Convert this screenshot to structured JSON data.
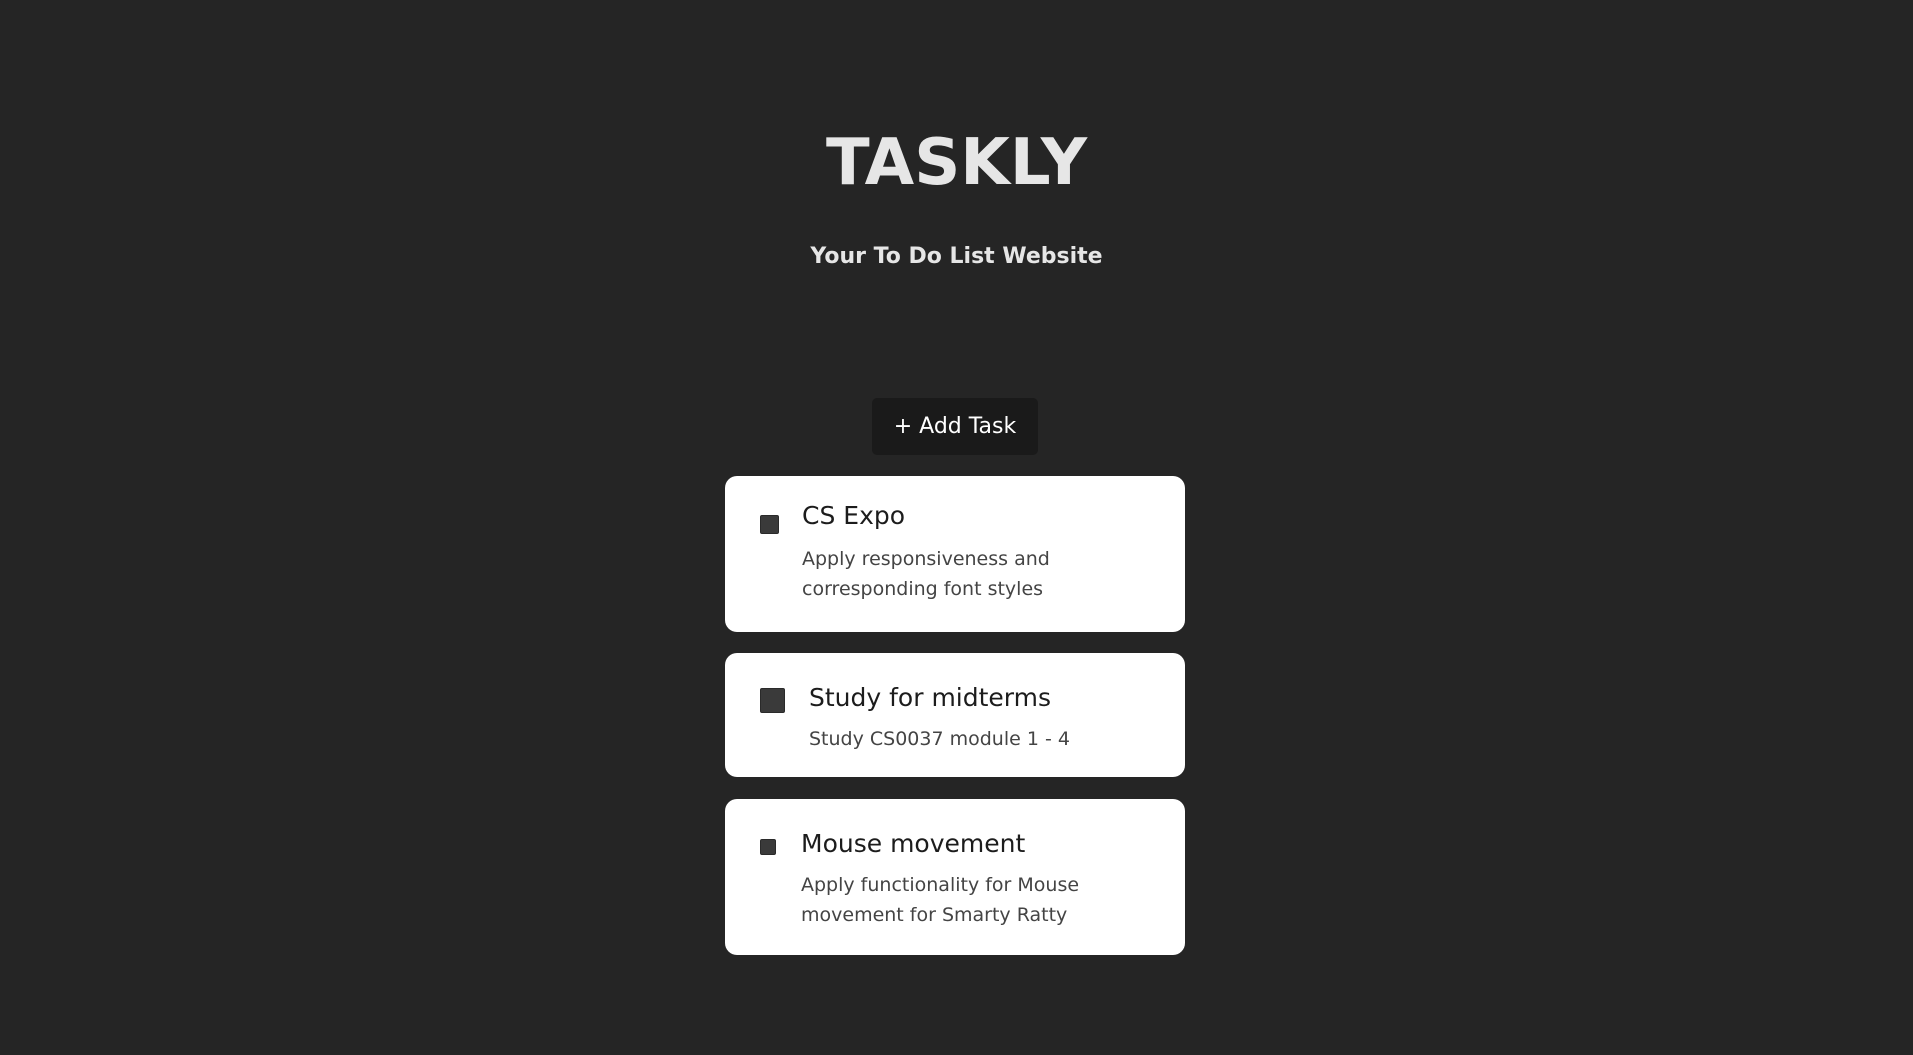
{
  "header": {
    "title": "TASKLY",
    "subtitle": "Your To Do List Website"
  },
  "toolbar": {
    "add_task_label": "+ Add Task"
  },
  "tasks": [
    {
      "title": "CS Expo",
      "description": "Apply responsiveness and corresponding font styles",
      "completed": false
    },
    {
      "title": "Study for midterms",
      "description": "Study CS0037 module 1 - 4",
      "completed": false
    },
    {
      "title": "Mouse movement",
      "description": "Apply functionality for Mouse movement for Smarty Ratty",
      "completed": false
    }
  ],
  "colors": {
    "background": "#252525",
    "card": "#ffffff",
    "button": "#1a1a1a",
    "checkbox": "#3a3a3a"
  }
}
